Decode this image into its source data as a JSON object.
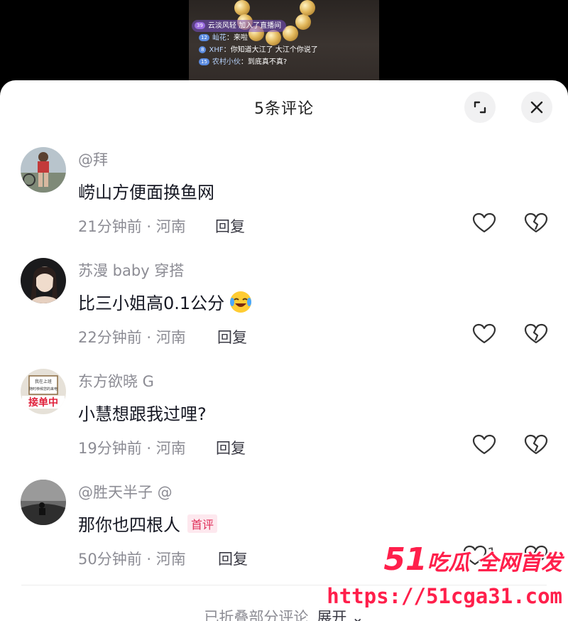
{
  "stream": {
    "join_level": "39",
    "join_user": "云淡风轻",
    "join_text": "加入了直播间",
    "messages": [
      {
        "level": "12",
        "user": "屾花",
        "text": "来啦"
      },
      {
        "level": "8",
        "user": "XHF",
        "text": "你知道大江了 大江个你说了"
      },
      {
        "level": "15",
        "user": "农村小伙",
        "text": "到底真不真?"
      }
    ]
  },
  "sheet": {
    "title": "5条评论",
    "expand_icon": "expand-icon",
    "close_icon": "close-icon"
  },
  "comments": [
    {
      "name": "@拜",
      "text": "崂山方便面换鱼网",
      "time": "21分钟前",
      "location": "河南",
      "reply": "回复",
      "likes": "",
      "badge": ""
    },
    {
      "name": "苏漫 baby 穿搭",
      "text": "比三小姐高0.1公分",
      "emoji": "laughing-crying-emoji",
      "time": "22分钟前",
      "location": "河南",
      "reply": "回复",
      "likes": "",
      "badge": ""
    },
    {
      "name": "东方欲晓 G",
      "text": "小慧想跟我过哩?",
      "time": "19分钟前",
      "location": "河南",
      "reply": "回复",
      "likes": "",
      "badge": "",
      "avatar_text": "接单中",
      "avatar_sign": "我在上班 随时恭候您的来电"
    },
    {
      "name": "@胜天半子 @",
      "text": "那你也四根人",
      "time": "50分钟前",
      "location": "河南",
      "reply": "回复",
      "likes": "1",
      "badge": "首评"
    }
  ],
  "folded": {
    "text": "已折叠部分评论",
    "expand": "展开"
  },
  "watermark": {
    "brand_num": "51",
    "brand_text": "吃瓜 全网首发",
    "url": "https://51cga31.com"
  },
  "colors": {
    "accent": "#e0305a",
    "watermark": "#ff1f4b",
    "meta_gray": "#8c8c94"
  }
}
